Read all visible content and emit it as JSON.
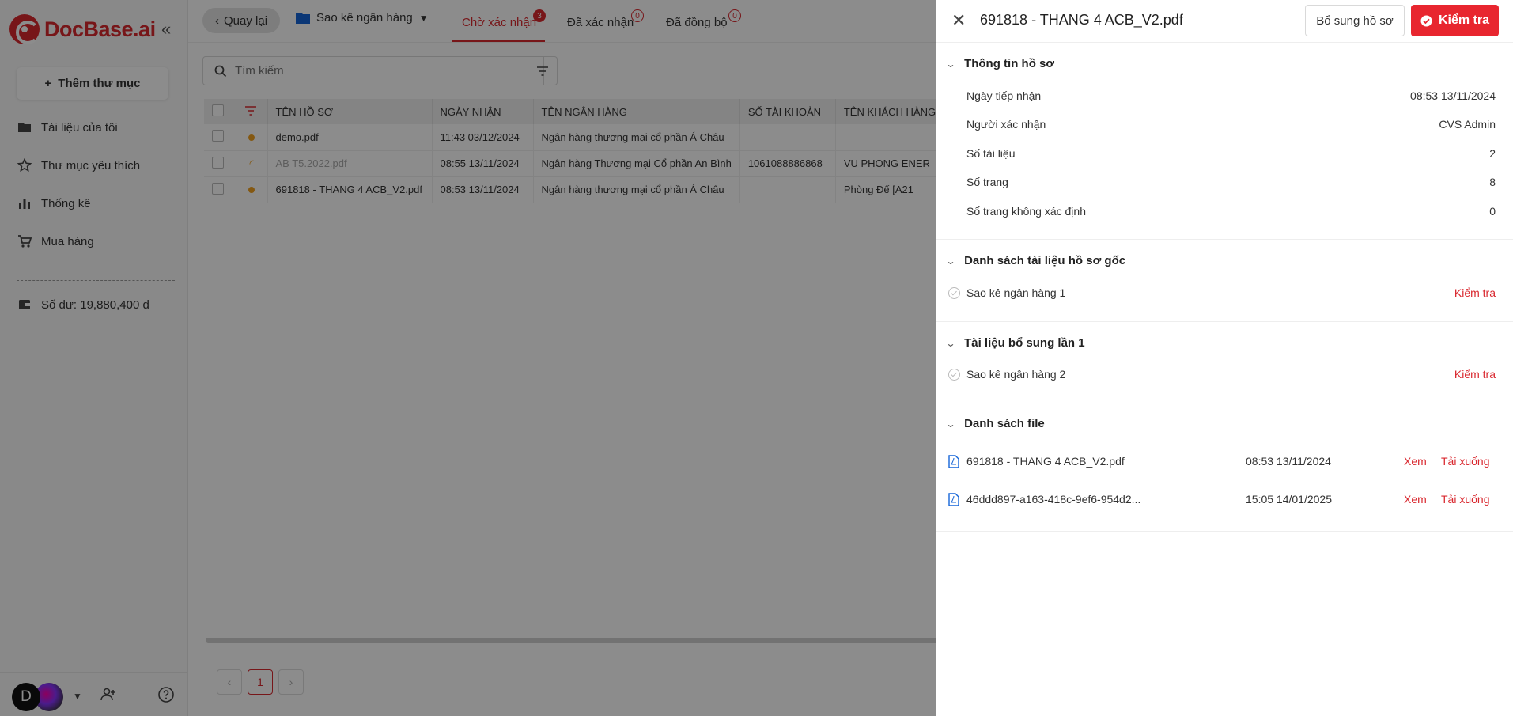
{
  "app": {
    "brand": "DocBase.ai"
  },
  "sidebar": {
    "add_folder_label": "Thêm thư mục",
    "items": [
      {
        "label": "Tài liệu của tôi",
        "icon": "folder-icon"
      },
      {
        "label": "Thư mục yêu thích",
        "icon": "star-icon"
      },
      {
        "label": "Thống kê",
        "icon": "bar-chart-icon"
      },
      {
        "label": "Mua hàng",
        "icon": "cart-icon"
      }
    ],
    "balance": "Số dư: 19,880,400 đ",
    "user_initial": "D"
  },
  "toolbar": {
    "back_label": "Quay lại",
    "folder_name": "Sao kê ngân hàng"
  },
  "tabs": [
    {
      "label": "Chờ xác nhận",
      "count": "3"
    },
    {
      "label": "Đã xác nhận",
      "count": "0"
    },
    {
      "label": "Đã đồng bộ",
      "count": "0"
    }
  ],
  "search": {
    "placeholder": "Tìm kiếm",
    "value": ""
  },
  "table": {
    "headers": [
      "TÊN HỒ SƠ",
      "NGÀY NHẬN",
      "TÊN NGÂN HÀNG",
      "SỐ TÀI KHOẢN",
      "TÊN KHÁCH HÀNG"
    ],
    "rows": [
      {
        "name": "demo.pdf",
        "date": "11:43 03/12/2024",
        "bank": "Ngân hàng thương mại cổ phần Á Châu",
        "account": "",
        "customer": ""
      },
      {
        "name": "AB T5.2022.pdf",
        "date": "08:55 13/11/2024",
        "bank": "Ngân hàng Thương mại Cổ phần An Bình",
        "account": "1061088886868",
        "customer": "VU PHONG ENER"
      },
      {
        "name": "691818 - THANG 4 ACB_V2.pdf",
        "date": "08:53 13/11/2024",
        "bank": "Ngân hàng thương mại cổ phần Á Châu",
        "account": "",
        "customer": "Phòng Đế [A21"
      }
    ]
  },
  "pagination": {
    "current": "1"
  },
  "drawer": {
    "title": "691818 - THANG 4 ACB_V2.pdf",
    "supplement_label": "Bổ sung hồ sơ",
    "check_label": "Kiểm tra",
    "info": {
      "title": "Thông tin hồ sơ",
      "fields": [
        {
          "label": "Ngày tiếp nhận",
          "value": "08:53 13/11/2024"
        },
        {
          "label": "Người xác nhận",
          "value": "CVS Admin"
        },
        {
          "label": "Số tài liệu",
          "value": "2"
        },
        {
          "label": "Số trang",
          "value": "8"
        },
        {
          "label": "Số trang không xác định",
          "value": "0"
        }
      ]
    },
    "original_docs": {
      "title": "Danh sách tài liệu hồ sơ gốc",
      "items": [
        {
          "name": "Sao kê ngân hàng 1",
          "action": "Kiểm tra"
        }
      ]
    },
    "supplement_docs": {
      "title": "Tài liệu bổ sung lần 1",
      "items": [
        {
          "name": "Sao kê ngân hàng 2",
          "action": "Kiểm tra"
        }
      ]
    },
    "files": {
      "title": "Danh sách file",
      "items": [
        {
          "name": "691818 - THANG 4 ACB_V2.pdf",
          "date": "08:53 13/11/2024",
          "view": "Xem",
          "download": "Tải xuống"
        },
        {
          "name": "46ddd897-a163-418c-9ef6-954d2...",
          "date": "15:05 14/01/2025",
          "view": "Xem",
          "download": "Tải xuống"
        }
      ]
    }
  },
  "colors": {
    "accent": "#d9282f",
    "badge": "#f0a020"
  }
}
